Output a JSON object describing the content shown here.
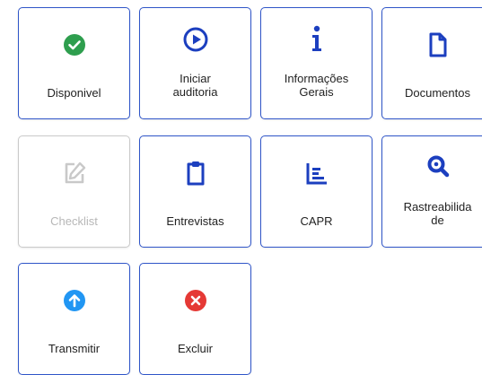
{
  "tiles": [
    {
      "label": "Disponivel",
      "icon": "check-circle-icon",
      "enabled": true
    },
    {
      "label": "Iniciar\nauditoria",
      "icon": "play-circle-icon",
      "enabled": true
    },
    {
      "label": "Informações\nGerais",
      "icon": "info-icon",
      "enabled": true
    },
    {
      "label": "Documentos",
      "icon": "document-icon",
      "enabled": true
    },
    {
      "label": "Checklist",
      "icon": "edit-icon",
      "enabled": false
    },
    {
      "label": "Entrevistas",
      "icon": "clipboard-icon",
      "enabled": true
    },
    {
      "label": "CAPR",
      "icon": "list-chart-icon",
      "enabled": true
    },
    {
      "label": "Rastreabilida\nde",
      "icon": "search-icon",
      "enabled": true
    },
    {
      "label": "Transmitir",
      "icon": "upload-arrow-icon",
      "enabled": true
    },
    {
      "label": "Excluir",
      "icon": "delete-circle-icon",
      "enabled": true
    }
  ],
  "colors": {
    "border": "#2f55c8",
    "primary": "#1c3fbf",
    "success": "#2e9e4e",
    "info": "#2196f3",
    "danger": "#e53935",
    "disabled": "#c9c9c9"
  }
}
